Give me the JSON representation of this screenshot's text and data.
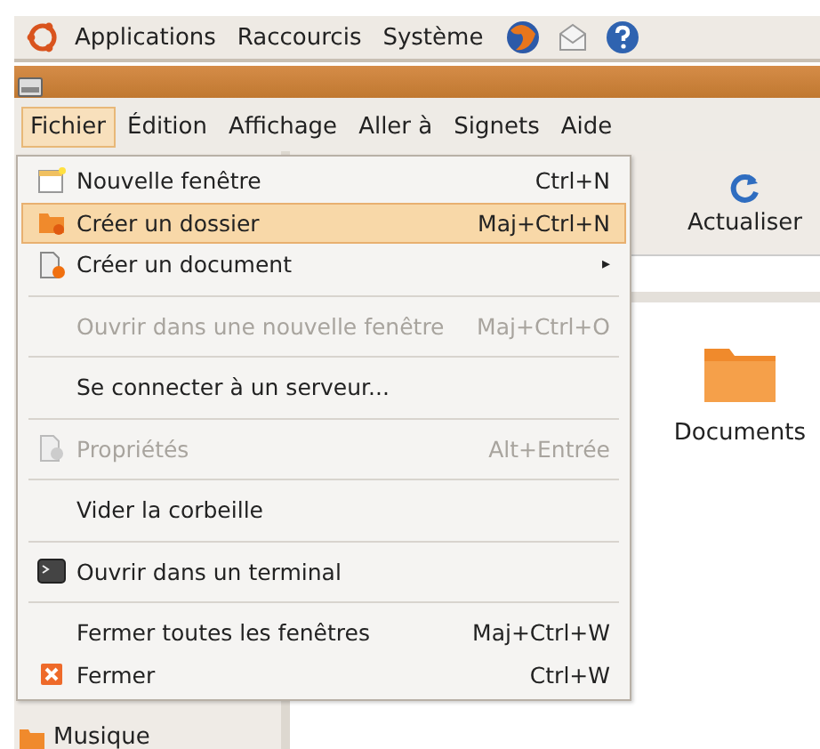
{
  "top_panel": {
    "menus": [
      "Applications",
      "Raccourcis",
      "Système"
    ]
  },
  "menubar": [
    {
      "label": "Fichier",
      "selected": true
    },
    {
      "label": "Édition",
      "selected": false
    },
    {
      "label": "Affichage",
      "selected": false
    },
    {
      "label": "Aller à",
      "selected": false
    },
    {
      "label": "Signets",
      "selected": false
    },
    {
      "label": "Aide",
      "selected": false
    }
  ],
  "toolbar": {
    "buttons": [
      "Actualiser"
    ]
  },
  "content": {
    "items": [
      "Documents"
    ]
  },
  "sidebar": {
    "items": [
      "Musique"
    ]
  },
  "file_menu": [
    {
      "kind": "item",
      "label": "Nouvelle fenêtre",
      "shortcut": "Ctrl+N",
      "selected": false,
      "disabled": false
    },
    {
      "kind": "item",
      "label": "Créer un dossier",
      "shortcut": "Maj+Ctrl+N",
      "selected": true,
      "disabled": false
    },
    {
      "kind": "submenu",
      "label": "Créer un document",
      "shortcut": "▸",
      "selected": false,
      "disabled": false
    },
    {
      "kind": "separator"
    },
    {
      "kind": "item",
      "label": "Ouvrir dans une nouvelle fenêtre",
      "shortcut": "Maj+Ctrl+O",
      "selected": false,
      "disabled": true
    },
    {
      "kind": "separator"
    },
    {
      "kind": "item",
      "label": "Se connecter à un serveur...",
      "selected": false,
      "disabled": false
    },
    {
      "kind": "separator"
    },
    {
      "kind": "item",
      "label": "Propriétés",
      "shortcut": "Alt+Entrée",
      "selected": false,
      "disabled": true
    },
    {
      "kind": "separator"
    },
    {
      "kind": "item",
      "label": "Vider la corbeille",
      "selected": false,
      "disabled": false
    },
    {
      "kind": "separator"
    },
    {
      "kind": "item",
      "label": "Ouvrir dans un terminal",
      "selected": false,
      "disabled": false
    },
    {
      "kind": "separator"
    },
    {
      "kind": "item",
      "label": "Fermer toutes les fenêtres",
      "shortcut": "Maj+Ctrl+W",
      "selected": false,
      "disabled": false
    },
    {
      "kind": "item",
      "label": "Fermer",
      "shortcut": "Ctrl+W",
      "selected": false,
      "disabled": false
    }
  ]
}
